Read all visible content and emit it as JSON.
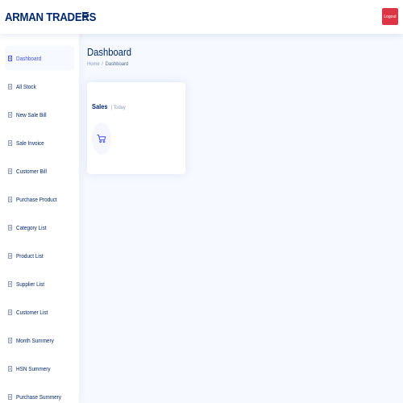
{
  "header": {
    "brand": "ARMAN TRADERS",
    "logout_label": "Logout"
  },
  "sidebar": {
    "items": [
      {
        "label": "Dashboard"
      },
      {
        "label": "All Stock"
      },
      {
        "label": "New Sale Bill"
      },
      {
        "label": "Sale Invoice"
      },
      {
        "label": "Customer Bill"
      },
      {
        "label": "Purchase Product"
      },
      {
        "label": "Category List"
      },
      {
        "label": "Product List"
      },
      {
        "label": "Supplier List"
      },
      {
        "label": "Customer List"
      },
      {
        "label": "Month Summery"
      },
      {
        "label": "HSN Summery"
      },
      {
        "label": "Purchase Summery"
      }
    ],
    "active_index": 0,
    "item_icon": "document-icon"
  },
  "main": {
    "title": "Dashboard",
    "breadcrumb": {
      "home": "Home",
      "separator": "/",
      "current": "Dashboard"
    },
    "sales_card": {
      "title": "Sales",
      "subtitle": "| Today",
      "icon": "cart-icon"
    }
  },
  "colors": {
    "brand_text": "#012970",
    "accent": "#4154f1",
    "logout": "#dc3545",
    "background": "#f6f9ff"
  }
}
